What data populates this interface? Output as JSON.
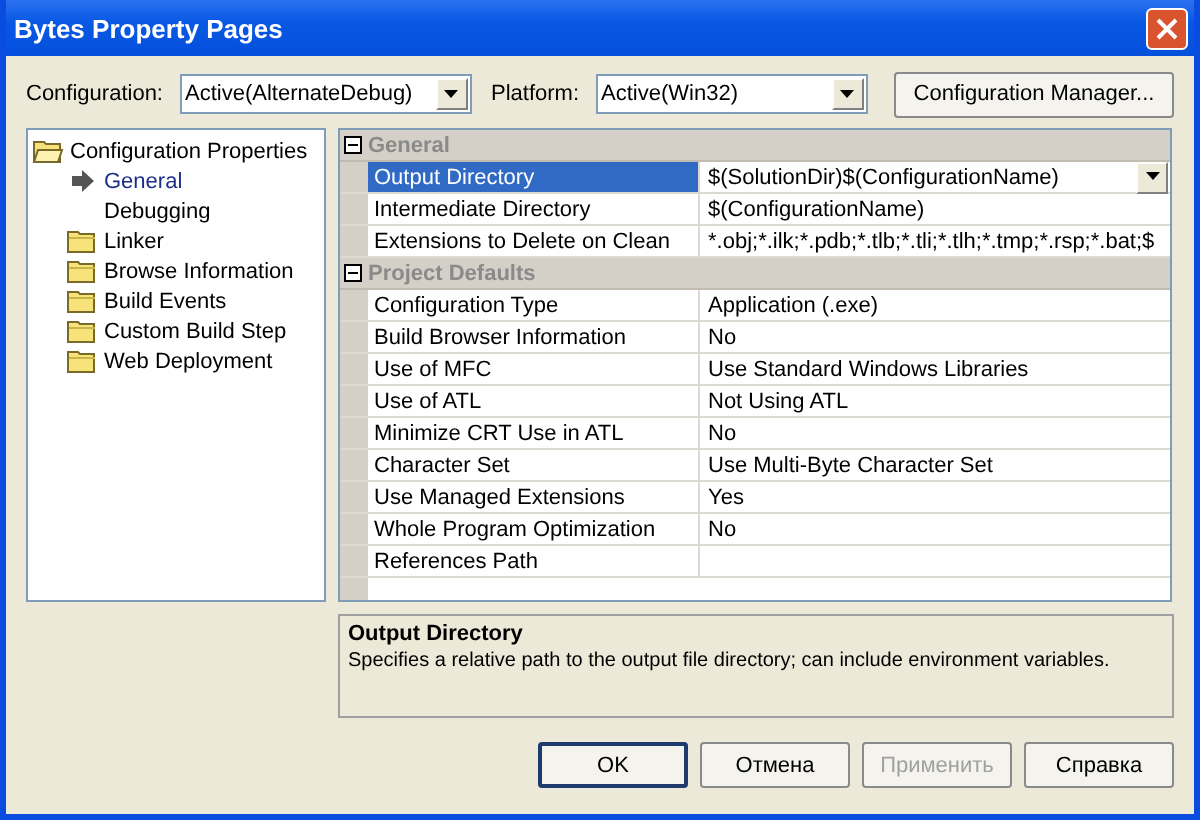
{
  "window": {
    "title": "Bytes Property Pages"
  },
  "toolbar": {
    "configuration_label": "Configuration:",
    "configuration_value": "Active(AlternateDebug)",
    "platform_label": "Platform:",
    "platform_value": "Active(Win32)",
    "manager_button": "Configuration Manager..."
  },
  "tree": [
    {
      "label": "Configuration Properties",
      "kind": "folder",
      "expanded": true,
      "selected": false,
      "children": [
        {
          "label": "General",
          "kind": "page",
          "selected": true
        },
        {
          "label": "Debugging",
          "kind": "plain",
          "selected": false
        },
        {
          "label": "Linker",
          "kind": "folder",
          "selected": false
        },
        {
          "label": "Browse Information",
          "kind": "folder",
          "selected": false
        },
        {
          "label": "Build Events",
          "kind": "folder",
          "selected": false
        },
        {
          "label": "Custom Build Step",
          "kind": "folder",
          "selected": false
        },
        {
          "label": "Web Deployment",
          "kind": "folder",
          "selected": false
        }
      ]
    }
  ],
  "grid": [
    {
      "category": "General",
      "expanded": true,
      "properties": [
        {
          "name": "Output Directory",
          "value": "$(SolutionDir)$(ConfigurationName)",
          "selected": true
        },
        {
          "name": "Intermediate Directory",
          "value": "$(ConfigurationName)",
          "selected": false
        },
        {
          "name": "Extensions to Delete on Clean",
          "value": "*.obj;*.ilk;*.pdb;*.tlb;*.tli;*.tlh;*.tmp;*.rsp;*.bat;$",
          "selected": false
        }
      ]
    },
    {
      "category": "Project Defaults",
      "expanded": true,
      "properties": [
        {
          "name": "Configuration Type",
          "value": "Application (.exe)",
          "selected": false
        },
        {
          "name": "Build Browser Information",
          "value": "No",
          "selected": false
        },
        {
          "name": "Use of MFC",
          "value": "Use Standard Windows Libraries",
          "selected": false
        },
        {
          "name": "Use of ATL",
          "value": "Not Using ATL",
          "selected": false
        },
        {
          "name": "Minimize CRT Use in ATL",
          "value": "No",
          "selected": false
        },
        {
          "name": "Character Set",
          "value": "Use Multi-Byte Character Set",
          "selected": false
        },
        {
          "name": "Use Managed Extensions",
          "value": "Yes",
          "selected": false
        },
        {
          "name": "Whole Program Optimization",
          "value": "No",
          "selected": false
        },
        {
          "name": "References Path",
          "selected": false
        }
      ]
    }
  ],
  "description": {
    "title": "Output Directory",
    "text": "Specifies a relative path to the output file directory; can include environment variables."
  },
  "buttons": [
    {
      "label": "OK",
      "default": true,
      "disabled": false
    },
    {
      "label": "Отмена",
      "default": false,
      "disabled": false
    },
    {
      "label": "Применить",
      "default": false,
      "disabled": true
    },
    {
      "label": "Справка",
      "default": false,
      "disabled": false
    }
  ]
}
